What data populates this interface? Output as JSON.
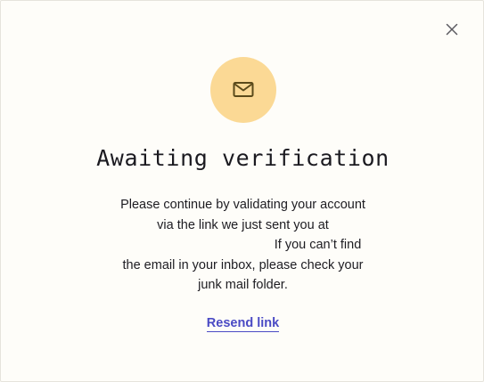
{
  "dialog": {
    "title": "Awaiting verification",
    "message": {
      "line1": "Please continue by validating your account",
      "line2": "via the link we just sent you at",
      "line3_suffix": "If you can’t find",
      "line4": "the email in your inbox, please check your",
      "line5": "junk mail folder."
    },
    "resend_label": "Resend link",
    "icon": "mail-icon",
    "close_icon": "close-icon"
  },
  "colors": {
    "background": "#fefdf9",
    "icon_circle": "#fbd995",
    "icon_stroke": "#5a4a1a",
    "link": "#4a4ac4",
    "text": "#1d1c22"
  }
}
